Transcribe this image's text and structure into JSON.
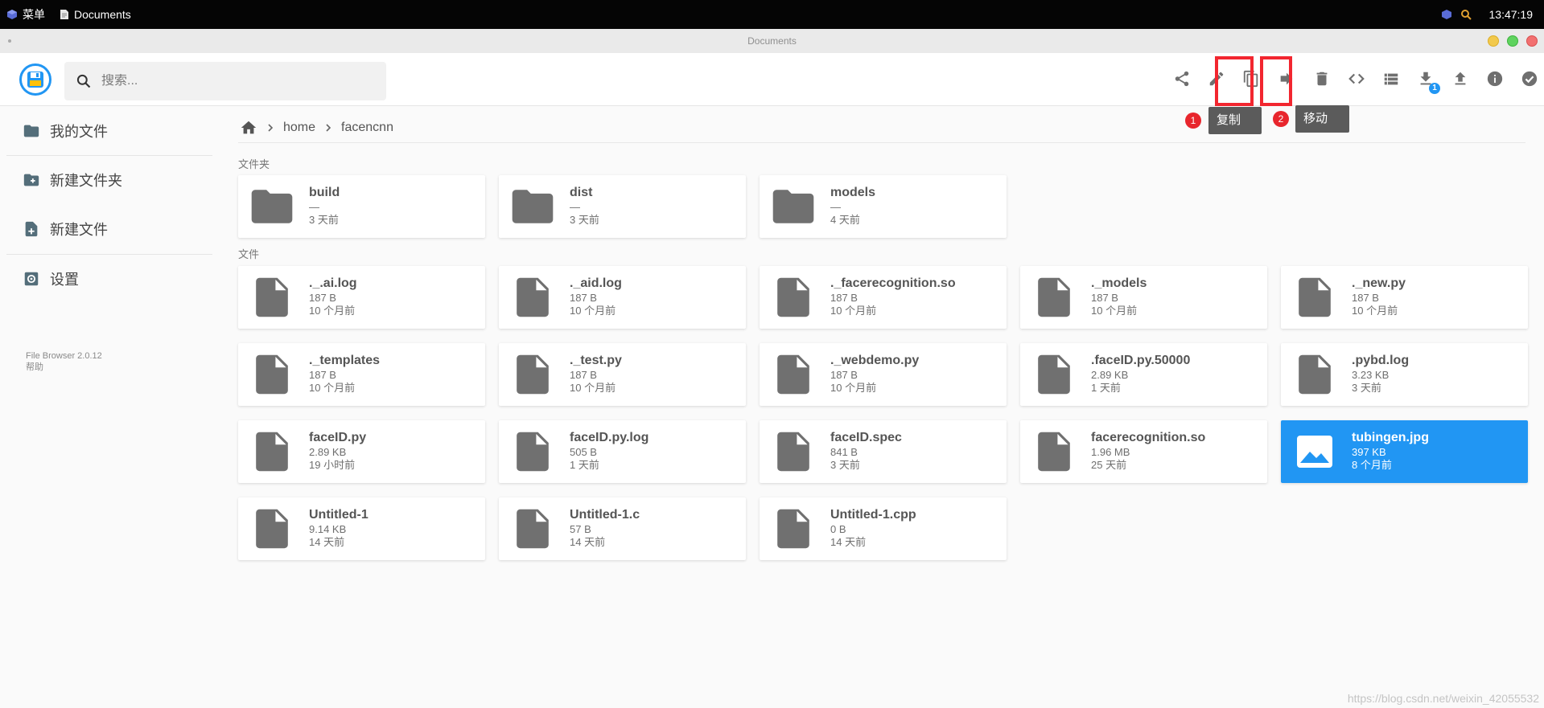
{
  "taskbar": {
    "menu_label": "菜单",
    "window_label": "Documents",
    "clock": "13:47:19"
  },
  "window": {
    "title": "Documents"
  },
  "search": {
    "placeholder": "搜索..."
  },
  "annotations": {
    "copy": {
      "number": "1",
      "tooltip": "复制"
    },
    "move": {
      "number": "2",
      "tooltip": "移动"
    },
    "download_badge": "1"
  },
  "sidebar": {
    "items": [
      {
        "label": "我的文件"
      },
      {
        "label": "新建文件夹"
      },
      {
        "label": "新建文件"
      },
      {
        "label": "设置"
      }
    ],
    "version": "File Browser 2.0.12",
    "help": "帮助"
  },
  "breadcrumb": [
    "home",
    "facencnn"
  ],
  "sections": {
    "folders": "文件夹",
    "files": "文件"
  },
  "folders": [
    {
      "name": "build",
      "size": "—",
      "modified": "3 天前"
    },
    {
      "name": "dist",
      "size": "—",
      "modified": "3 天前"
    },
    {
      "name": "models",
      "size": "—",
      "modified": "4 天前"
    }
  ],
  "files": [
    {
      "name": "._.ai.log",
      "size": "187 B",
      "modified": "10 个月前"
    },
    {
      "name": "._aid.log",
      "size": "187 B",
      "modified": "10 个月前"
    },
    {
      "name": "._facerecognition.so",
      "size": "187 B",
      "modified": "10 个月前"
    },
    {
      "name": "._models",
      "size": "187 B",
      "modified": "10 个月前"
    },
    {
      "name": "._new.py",
      "size": "187 B",
      "modified": "10 个月前"
    },
    {
      "name": "._templates",
      "size": "187 B",
      "modified": "10 个月前"
    },
    {
      "name": "._test.py",
      "size": "187 B",
      "modified": "10 个月前"
    },
    {
      "name": "._webdemo.py",
      "size": "187 B",
      "modified": "10 个月前"
    },
    {
      "name": ".faceID.py.50000",
      "size": "2.89 KB",
      "modified": "1 天前"
    },
    {
      "name": ".pybd.log",
      "size": "3.23 KB",
      "modified": "3 天前"
    },
    {
      "name": "faceID.py",
      "size": "2.89 KB",
      "modified": "19 小时前"
    },
    {
      "name": "faceID.py.log",
      "size": "505 B",
      "modified": "1 天前"
    },
    {
      "name": "faceID.spec",
      "size": "841 B",
      "modified": "3 天前"
    },
    {
      "name": "facerecognition.so",
      "size": "1.96 MB",
      "modified": "25 天前"
    },
    {
      "name": "tubingen.jpg",
      "size": "397 KB",
      "modified": "8 个月前",
      "selected": true,
      "icon": "image-icon"
    },
    {
      "name": "Untitled-1",
      "size": "9.14 KB",
      "modified": "14 天前"
    },
    {
      "name": "Untitled-1.c",
      "size": "57 B",
      "modified": "14 天前"
    },
    {
      "name": "Untitled-1.cpp",
      "size": "0 B",
      "modified": "14 天前"
    }
  ],
  "watermark": "https://blog.csdn.net/weixin_42055532",
  "colors": {
    "accent": "#2196f3",
    "highlight": "#f2262f",
    "icon": "#6f6f6f"
  }
}
